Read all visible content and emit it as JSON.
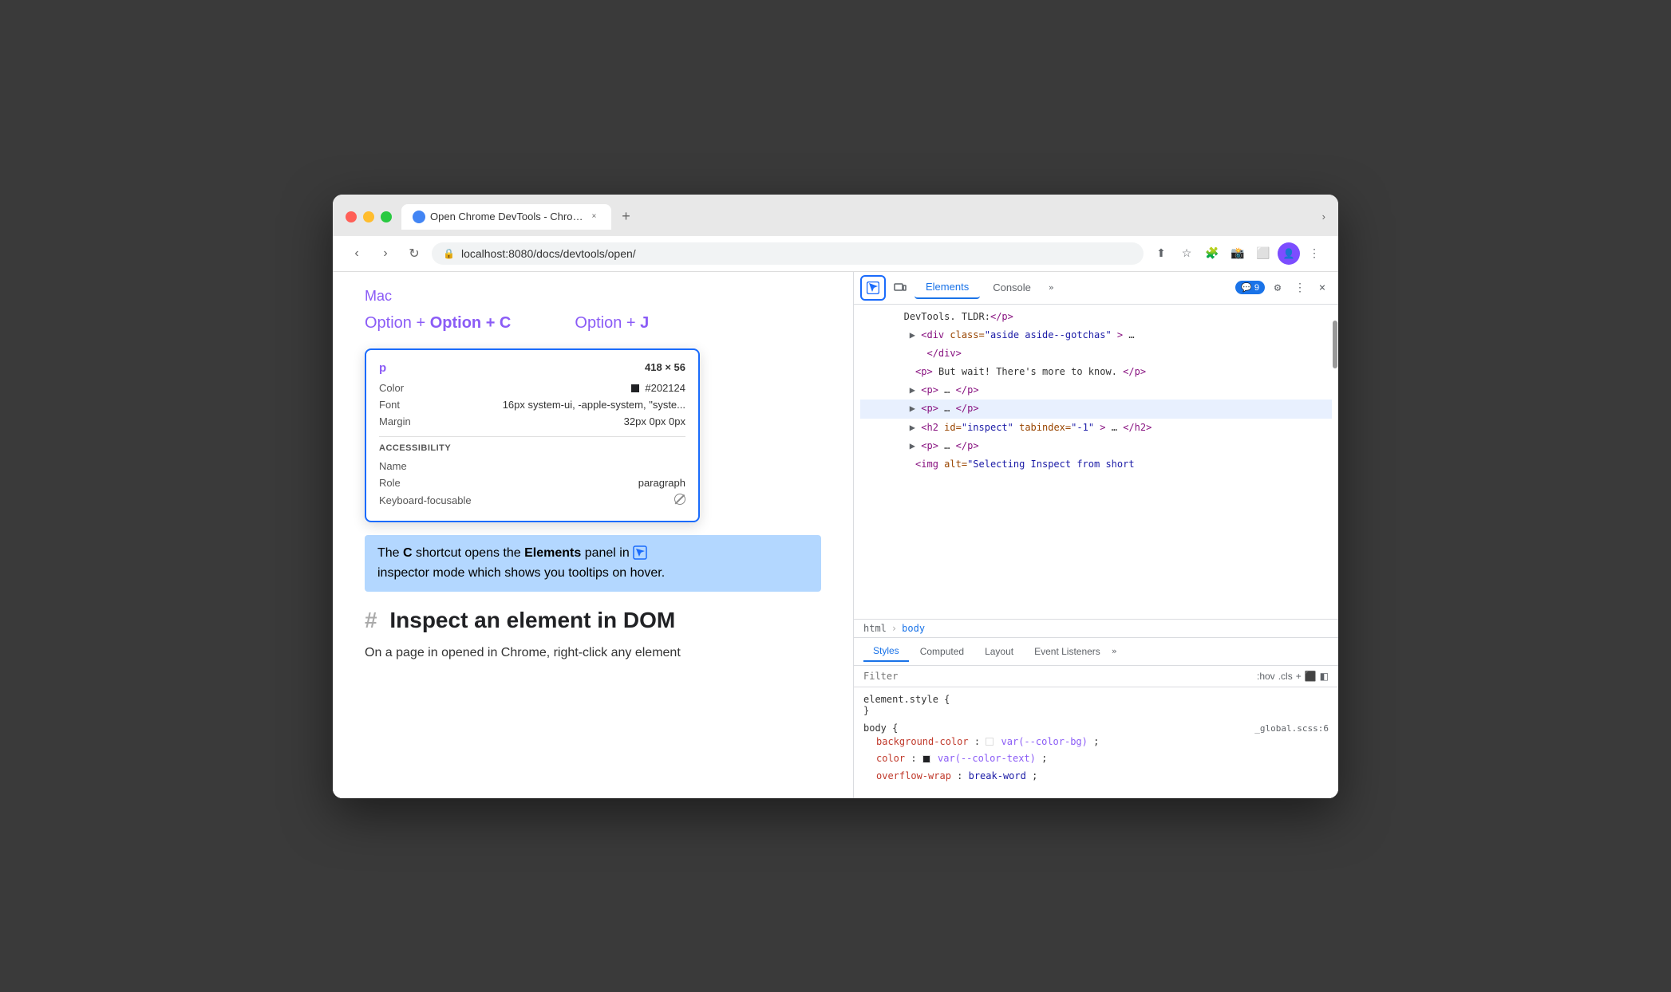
{
  "window": {
    "title": "Open Chrome DevTools - Chro…",
    "tab_close": "×",
    "new_tab": "+",
    "chevron_down": "›"
  },
  "nav": {
    "back": "‹",
    "forward": "›",
    "refresh": "↻",
    "url": "localhost:8080/docs/devtools/open/",
    "lock_icon": "🔒",
    "share": "⬆",
    "bookmark": "☆",
    "extensions": "🧩",
    "profile": "👤",
    "menu": "⋮"
  },
  "page": {
    "mac_label": "Mac",
    "shortcut_c": "Option + C",
    "shortcut_j": "Option + J",
    "tooltip": {
      "tag": "p",
      "size": "418 × 56",
      "color_label": "Color",
      "color_value": "#202124",
      "font_label": "Font",
      "font_value": "16px system-ui, -apple-system, \"syste...",
      "margin_label": "Margin",
      "margin_value": "32px 0px 0px",
      "accessibility_label": "ACCESSIBILITY",
      "name_label": "Name",
      "role_label": "Role",
      "role_value": "paragraph",
      "keyboard_label": "Keyboard-focusable"
    },
    "highlighted_text_line1": "The C shortcut opens the Elements panel in",
    "highlighted_text_bold": "Elements",
    "highlighted_text_line2": "inspector mode which shows you tooltips on hover.",
    "section_hash": "#",
    "section_heading": "Inspect an element in DOM",
    "body_text": "On a page in opened in Chrome, right-click any element"
  },
  "devtools": {
    "inspector_icon": "⬚",
    "toggle_icon": "⬜",
    "tabs": [
      "Elements",
      "Console"
    ],
    "more_tabs": "»",
    "chat_badge": "9",
    "settings_icon": "⚙",
    "more_icon": "⋮",
    "close_icon": "×",
    "dom_lines": [
      {
        "indent": 0,
        "content": "DevTools. TLDR:</p>"
      },
      {
        "indent": 1,
        "content": "<div class=\"aside aside--gotchas\">…"
      },
      {
        "indent": 2,
        "content": "</div>"
      },
      {
        "indent": 2,
        "content": "<p>But wait! There's more to know.</p>"
      },
      {
        "indent": 2,
        "content": "▶<p>…</p>",
        "selected": false
      },
      {
        "indent": 2,
        "content": "▶<p>…</p>",
        "selected": true
      },
      {
        "indent": 2,
        "content": "▶<h2 id=\"inspect\" tabindex=\"-1\">…</h2>"
      },
      {
        "indent": 2,
        "content": "▶<p>…</p>"
      },
      {
        "indent": 2,
        "content": "<img alt=\"Selecting Inspect from short"
      }
    ],
    "breadcrumbs": [
      "html",
      "body"
    ],
    "styles_tabs": [
      "Styles",
      "Computed",
      "Layout",
      "Event Listeners"
    ],
    "styles_more": "»",
    "filter_placeholder": "Filter",
    "filter_hov": ":hov",
    "filter_cls": ".cls",
    "filter_plus": "+",
    "styles_content": [
      {
        "selector": "element.style {",
        "close": "}",
        "source": "",
        "properties": []
      },
      {
        "selector": "body {",
        "close": "}",
        "source": "_global.scss:6",
        "properties": [
          {
            "name": "background-color",
            "value": "var(--color-bg)",
            "has_swatch": true,
            "swatch_color": "white"
          },
          {
            "name": "color",
            "value": "var(--color-text)",
            "has_swatch": true,
            "swatch_color": "#202124"
          },
          {
            "name": "overflow-wrap",
            "value": "break-word"
          }
        ]
      }
    ]
  }
}
